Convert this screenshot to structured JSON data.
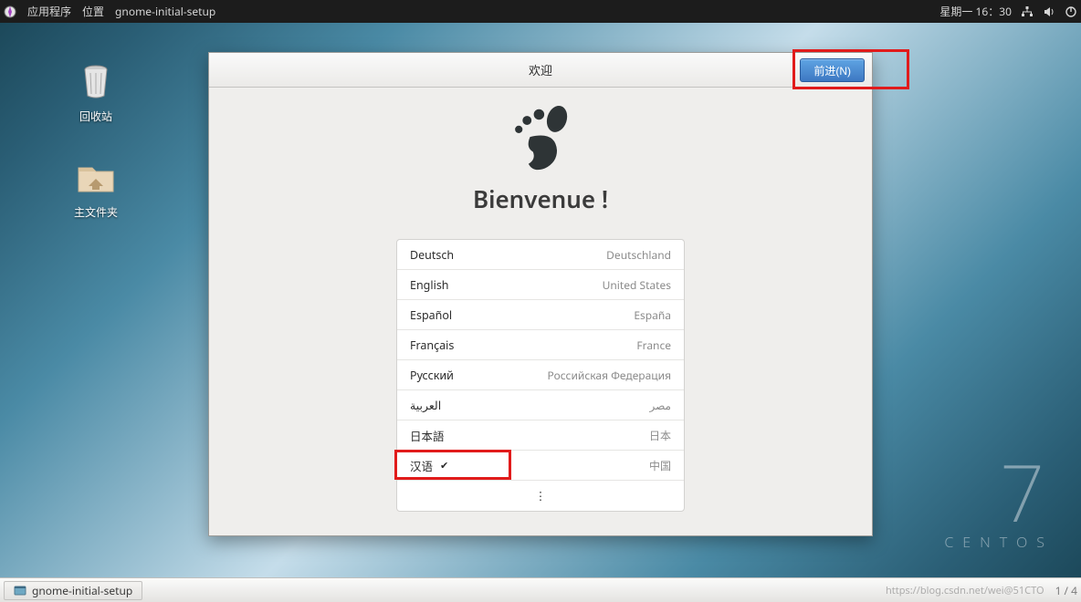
{
  "topbar": {
    "menu_applications": "应用程序",
    "menu_locations": "位置",
    "menu_process": "gnome-initial-setup",
    "date_time": "星期一 16：30"
  },
  "desktop": {
    "trash_label": "回收站",
    "home_label": "主文件夹"
  },
  "brand": {
    "number": "7",
    "name": "CENTOS"
  },
  "window": {
    "header_title": "欢迎",
    "next_label": "前进(N)",
    "welcome_heading": "Bienvenue !",
    "languages": [
      {
        "name": "Deutsch",
        "country": "Deutschland",
        "selected": false
      },
      {
        "name": "English",
        "country": "United States",
        "selected": false
      },
      {
        "name": "Español",
        "country": "España",
        "selected": false
      },
      {
        "name": "Français",
        "country": "France",
        "selected": false
      },
      {
        "name": "Русский",
        "country": "Российская Федерация",
        "selected": false
      },
      {
        "name": "العربية",
        "country": "مصر",
        "selected": false
      },
      {
        "name": "日本語",
        "country": "日本",
        "selected": false
      },
      {
        "name": "汉语",
        "country": "中国",
        "selected": true
      }
    ],
    "more_glyph": "⋮"
  },
  "taskbar": {
    "task_label": "gnome-initial-setup",
    "watermark": "https://blog.csdn.net/wei@51CTO",
    "pager": "1 / 4"
  }
}
